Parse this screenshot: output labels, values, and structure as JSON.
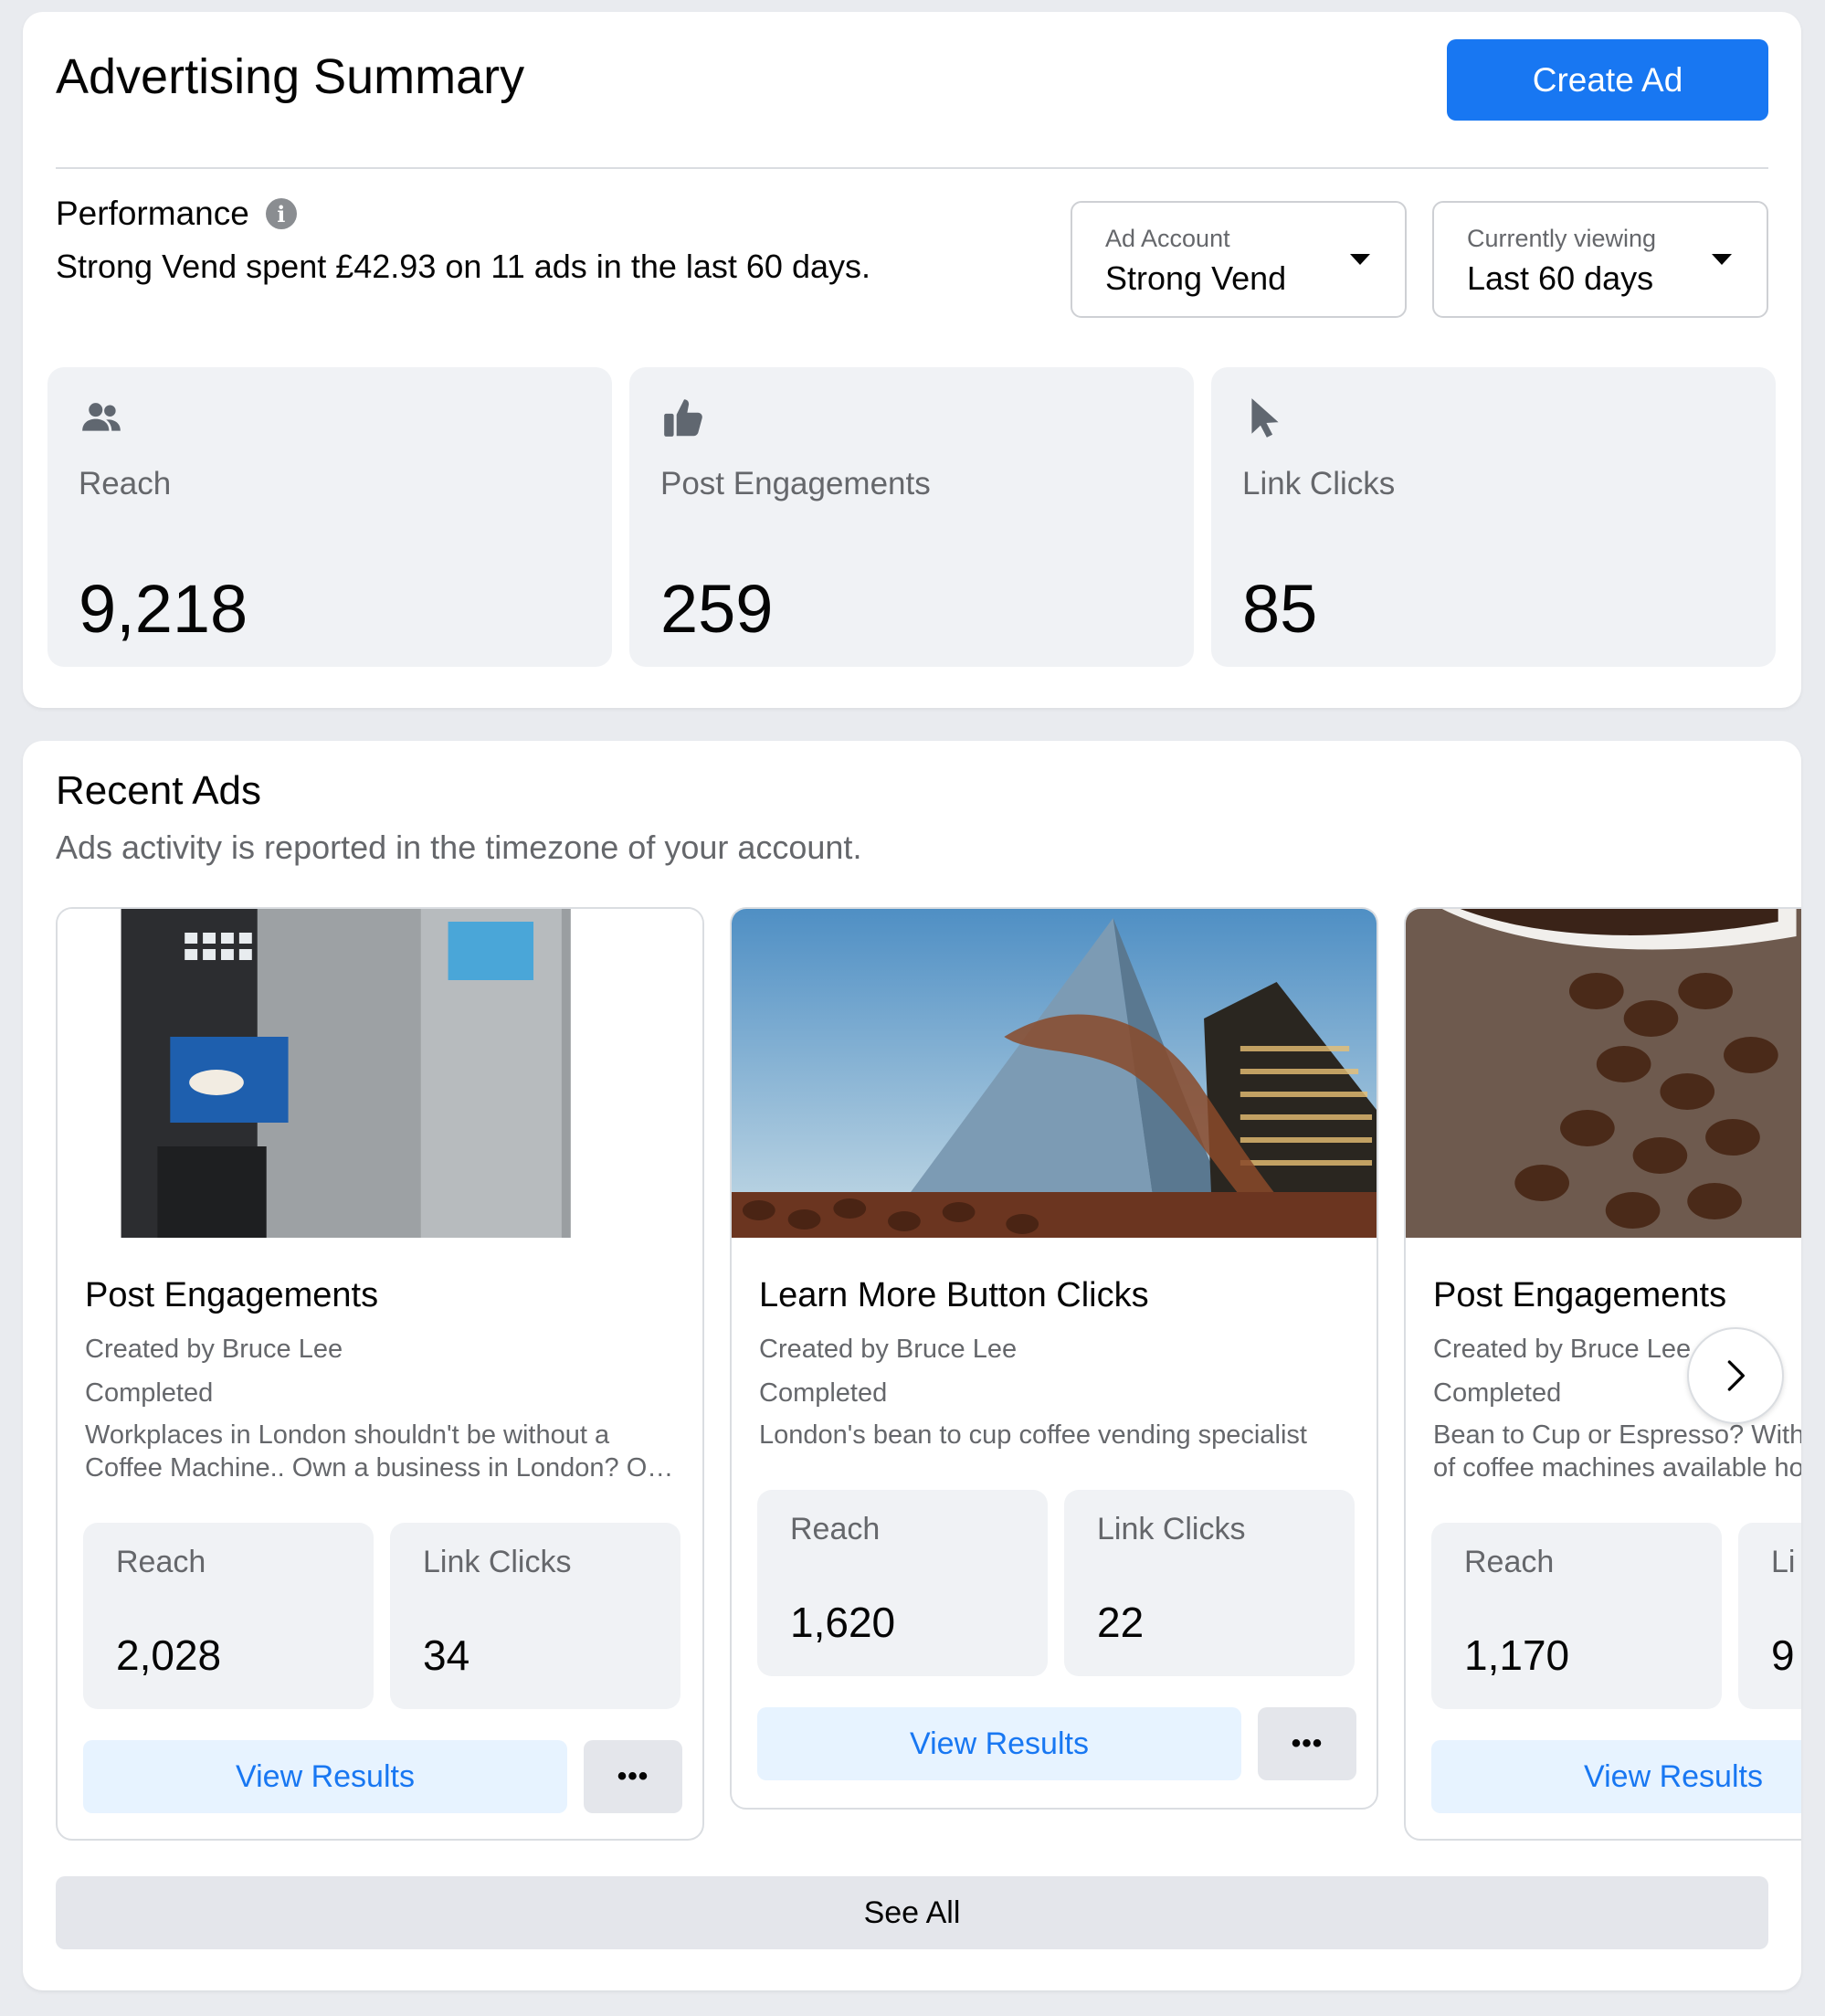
{
  "summary": {
    "title": "Advertising Summary",
    "create_ad_label": "Create Ad",
    "performance_title": "Performance",
    "performance_desc": "Strong Vend spent £42.93 on 11 ads in the last 60 days.",
    "account_dropdown": {
      "label": "Ad Account",
      "value": "Strong Vend"
    },
    "period_dropdown": {
      "label": "Currently viewing",
      "value": "Last 60 days"
    },
    "metrics": [
      {
        "icon": "people-icon",
        "label": "Reach",
        "value": "9,218"
      },
      {
        "icon": "thumbs-up-icon",
        "label": "Post Engagements",
        "value": "259"
      },
      {
        "icon": "cursor-icon",
        "label": "Link Clicks",
        "value": "85"
      }
    ]
  },
  "recent": {
    "title": "Recent Ads",
    "subtitle": "Ads activity is reported in the timezone of your account.",
    "ads": [
      {
        "image": "coffee-vending-machine",
        "title": "Post Engagements",
        "created_by": "Created by Bruce Lee",
        "status": "Completed",
        "desc_line1": "Workplaces in London shouldn't be without a",
        "desc_line2": "Coffee Machine.. Own a business in London? O…",
        "stats": [
          {
            "label": "Reach",
            "value": "2,028"
          },
          {
            "label": "Link Clicks",
            "value": "34"
          }
        ],
        "view_label": "View Results",
        "more_label": "•••"
      },
      {
        "image": "london-skyscrapers-coffee-beans",
        "title": "Learn More Button Clicks",
        "created_by": "Created by Bruce Lee",
        "status": "Completed",
        "desc_line1": "London's bean to cup coffee vending specialist",
        "stats": [
          {
            "label": "Reach",
            "value": "1,620"
          },
          {
            "label": "Link Clicks",
            "value": "22"
          }
        ],
        "view_label": "View Results",
        "more_label": "•••"
      },
      {
        "image": "coffee-beans-cup",
        "title": "Post Engagements",
        "created_by": "Created by Bruce Lee",
        "status": "Completed",
        "desc_line1": "Bean to Cup or Espresso? With",
        "desc_line2": "of coffee machines available ho",
        "stats": [
          {
            "label": "Reach",
            "value": "1,170"
          },
          {
            "label": "Li",
            "value": "9"
          }
        ],
        "view_label": "View Results"
      }
    ],
    "see_all_label": "See All"
  },
  "colors": {
    "primary": "#1877f2",
    "secondary_bg": "#e7f3ff",
    "page_bg": "#e9ebef",
    "muted_text": "#65676b"
  }
}
